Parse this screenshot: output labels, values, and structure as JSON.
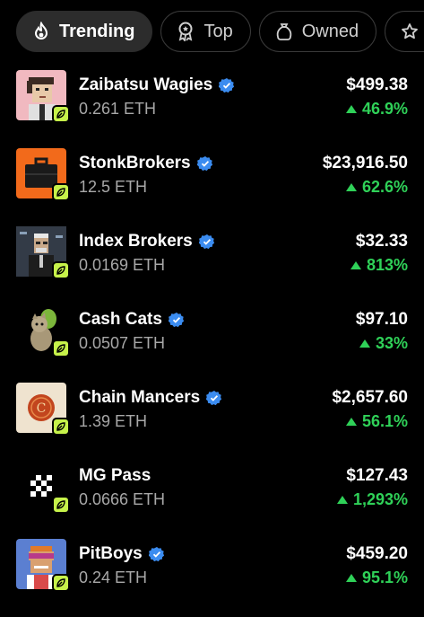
{
  "tabs": [
    {
      "label": "Trending",
      "icon": "flame-icon",
      "active": true
    },
    {
      "label": "Top",
      "icon": "ribbon-icon",
      "active": false
    },
    {
      "label": "Owned",
      "icon": "bag-icon",
      "active": false
    },
    {
      "label": "",
      "icon": "star-icon",
      "active": false
    }
  ],
  "collections": [
    {
      "name": "Zaibatsu Wagies",
      "eth": "0.261 ETH",
      "price": "$499.38",
      "change": "46.9%",
      "thumb_bg": "#f1b9c0"
    },
    {
      "name": "StonkBrokers",
      "eth": "12.5 ETH",
      "price": "$23,916.50",
      "change": "62.6%",
      "thumb_bg": "#f26a1b"
    },
    {
      "name": "Index Brokers",
      "eth": "0.0169 ETH",
      "price": "$32.33",
      "change": "813%",
      "thumb_bg": "#3d4654"
    },
    {
      "name": "Cash Cats",
      "eth": "0.0507 ETH",
      "price": "$97.10",
      "change": "33%",
      "thumb_bg": "#000000"
    },
    {
      "name": "Chain Mancers",
      "eth": "1.39 ETH",
      "price": "$2,657.60",
      "change": "56.1%",
      "thumb_bg": "#efe3cf"
    },
    {
      "name": "MG Pass",
      "eth": "0.0666 ETH",
      "price": "$127.43",
      "change": "1,293%",
      "thumb_bg": "#000000"
    },
    {
      "name": "PitBoys",
      "eth": "0.24 ETH",
      "price": "$459.20",
      "change": "95.1%",
      "thumb_bg": "#5b7fd1"
    }
  ],
  "colors": {
    "up": "#2fd158",
    "verified": "#3b8cf0",
    "badge": "#c6f24a"
  }
}
